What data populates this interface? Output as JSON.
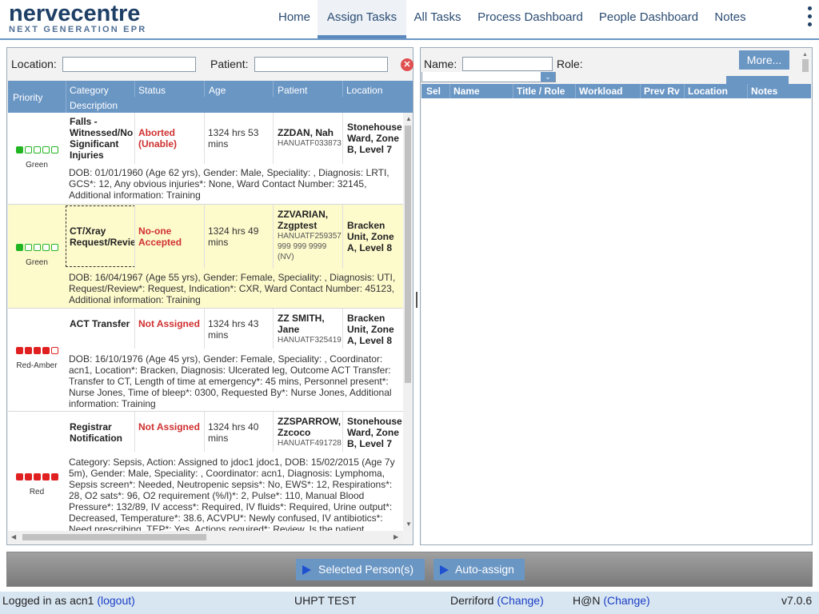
{
  "header": {
    "logo_main": "nervecentre",
    "logo_sub": "NEXT GENERATION EPR",
    "nav": [
      "Home",
      "Assign Tasks",
      "All Tasks",
      "Process Dashboard",
      "People Dashboard",
      "Notes"
    ],
    "active_nav": "Assign Tasks"
  },
  "left": {
    "location_label": "Location:",
    "location_value": "",
    "patient_label": "Patient:",
    "patient_value": "",
    "columns": {
      "priority": "Priority",
      "category": "Category",
      "description": "Description",
      "status": "Status",
      "age": "Age",
      "patient": "Patient",
      "location": "Location"
    },
    "tasks": [
      {
        "priority": "Green",
        "priority_filled": 1,
        "priority_color": "#22b522",
        "category": "Falls - Witnessed/No Significant Injuries",
        "status": "Aborted (Unable)",
        "age": "1324 hrs 53 mins",
        "patient_name": "ZZDAN, Nah",
        "patient_id": "HANUATF033873",
        "patient_extra": "",
        "location": "Stonehouse Ward, Zone B, Level 7",
        "description": "DOB: 01/01/1960 (Age 62 yrs), Gender: Male, Speciality: , Diagnosis: LRTI, GCS*: 12, Any obvious injuries*: None, Ward Contact Number: 32145, Additional information: Training"
      },
      {
        "priority": "Green",
        "priority_filled": 1,
        "priority_color": "#22b522",
        "category": "CT/Xray Request/Review",
        "status": "No-one Accepted",
        "age": "1324 hrs 49 mins",
        "patient_name": "ZZVARIAN, Zzgptest",
        "patient_id": "HANUATF259357",
        "patient_extra": "999 999 9999 (NV)",
        "location": "Bracken Unit, Zone A, Level 8",
        "description": "DOB: 16/04/1967 (Age 55 yrs), Gender: Female, Speciality: , Diagnosis: UTI, Request/Review*: Request, Indication*: CXR, Ward Contact Number: 45123, Additional information: Training"
      },
      {
        "priority": "Red-Amber",
        "priority_filled": 4,
        "priority_color": "#e02020",
        "category": "ACT Transfer",
        "status": "Not Assigned",
        "age": "1324 hrs 43 mins",
        "patient_name": "ZZ SMITH, Jane",
        "patient_id": "HANUATF325419",
        "patient_extra": "",
        "location": "Bracken Unit, Zone A, Level 8",
        "description": "DOB: 16/10/1976 (Age 45 yrs), Gender: Female, Speciality: , Coordinator: acn1, Location*: Bracken, Diagnosis: Ulcerated leg, Outcome ACT Transfer: Transfer to CT, Length of time at emergency*: 45 mins, Personnel present*: Nurse Jones, Time of bleep*: 0300, Requested By*: Nurse Jones, Additional information: Training"
      },
      {
        "priority": "Red",
        "priority_filled": 5,
        "priority_color": "#e02020",
        "category": "Registrar Notification",
        "status": "Not Assigned",
        "age": "1324 hrs 40 mins",
        "patient_name": "ZZSPARROW, Zzcoco",
        "patient_id": "HANUATF491728",
        "patient_extra": "",
        "location": "Stonehouse Ward, Zone B, Level 7",
        "description": "Category: Sepsis, Action: Assigned to jdoc1 jdoc1, DOB: 15/02/2015 (Age 7y 5m), Gender: Male, Speciality: , Coordinator: acn1, Diagnosis: Lymphoma, Sepsis screen*: Needed, Neutropenic sepsis*: No, EWS*: 12, Respirations*: 28, O2 sats*: 96, O2 requirement (%/l)*: 2, Pulse*: 110, Manual Blood Pressure*: 132/89, IV access*: Required, IV fluids*: Required, Urine output*: Decreased, Temperature*: 38.6, ACVPU*: Newly confused, IV antibiotics*: Need prescribing, TEP*: Yes, Actions required*: Review, Is the patient"
      }
    ]
  },
  "right": {
    "name_label": "Name:",
    "role_label": "Role:",
    "more_label": "More...",
    "columns": [
      "Sel",
      "Name",
      "Title / Role",
      "Workload",
      "Prev Rv",
      "Location",
      "Notes"
    ]
  },
  "actions": {
    "selected_label": "Selected Person(s)",
    "auto_label": "Auto-assign"
  },
  "footer": {
    "logged_in": "Logged in as acn1",
    "logout": "(logout)",
    "env": "UHPT TEST",
    "site": "Derriford",
    "site_change": "(Change)",
    "hospital": "H@N",
    "hospital_change": "(Change)",
    "version": "v7.0.6"
  }
}
